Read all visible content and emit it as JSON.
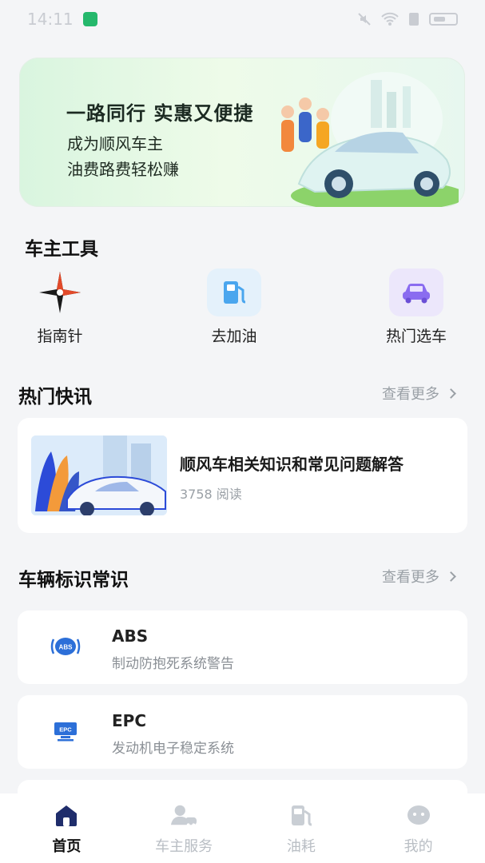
{
  "status_bar": {
    "time": "14:11"
  },
  "banner": {
    "title": "一路同行 实惠又便捷",
    "subtitle_line1": "成为顺风车主",
    "subtitle_line2": "油费路费轻松赚"
  },
  "tools": {
    "section_title": "车主工具",
    "items": [
      {
        "label": "指南针",
        "icon": "compass-icon"
      },
      {
        "label": "去加油",
        "icon": "fuel-pump-icon"
      },
      {
        "label": "热门选车",
        "icon": "car-icon"
      }
    ]
  },
  "news": {
    "section_title": "热门快讯",
    "more_label": "查看更多",
    "items": [
      {
        "title": "顺风车相关知识和常见问题解答",
        "meta": "3758 阅读"
      }
    ]
  },
  "signs": {
    "section_title": "车辆标识常识",
    "more_label": "查看更多",
    "items": [
      {
        "code": "ABS",
        "desc": "制动防抱死系统警告"
      },
      {
        "code": "EPC",
        "desc": "发动机电子稳定系统"
      }
    ]
  },
  "tabbar": {
    "items": [
      {
        "label": "首页",
        "active": true
      },
      {
        "label": "车主服务",
        "active": false
      },
      {
        "label": "油耗",
        "active": false
      },
      {
        "label": "我的",
        "active": false
      }
    ]
  },
  "colors": {
    "accent_blue": "#2c4bd8",
    "muted": "#9aa0a6",
    "active_tab": "#1f2d6b"
  }
}
